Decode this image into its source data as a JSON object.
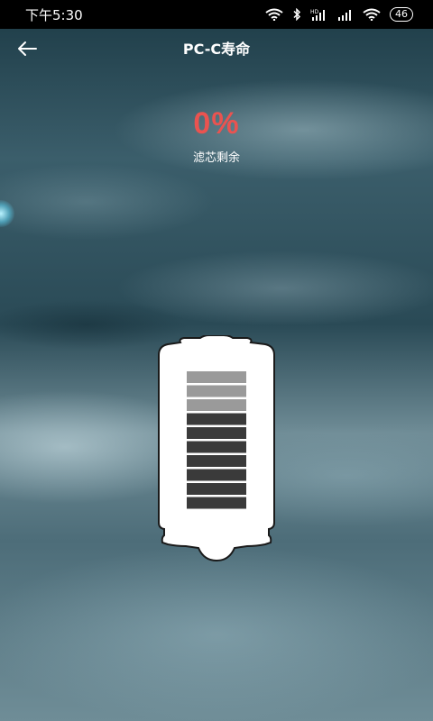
{
  "status_bar": {
    "time": "下午5:30",
    "battery_level": "46",
    "icons": [
      "wifi-icon",
      "bluetooth-icon",
      "hd-signal-icon",
      "signal-icon",
      "signal-icon",
      "wifi-icon"
    ]
  },
  "header": {
    "title": "PC-C寿命",
    "back_icon": "arrow-left-icon"
  },
  "filter": {
    "percent_text": "0%",
    "label": "滤芯剩余",
    "segments_total": 10,
    "segments_used": 3,
    "used_color": "#9a9a9a",
    "remaining_color": "#3a3a3a"
  },
  "colors": {
    "accent": "#ea5350",
    "text": "#ffffff"
  }
}
